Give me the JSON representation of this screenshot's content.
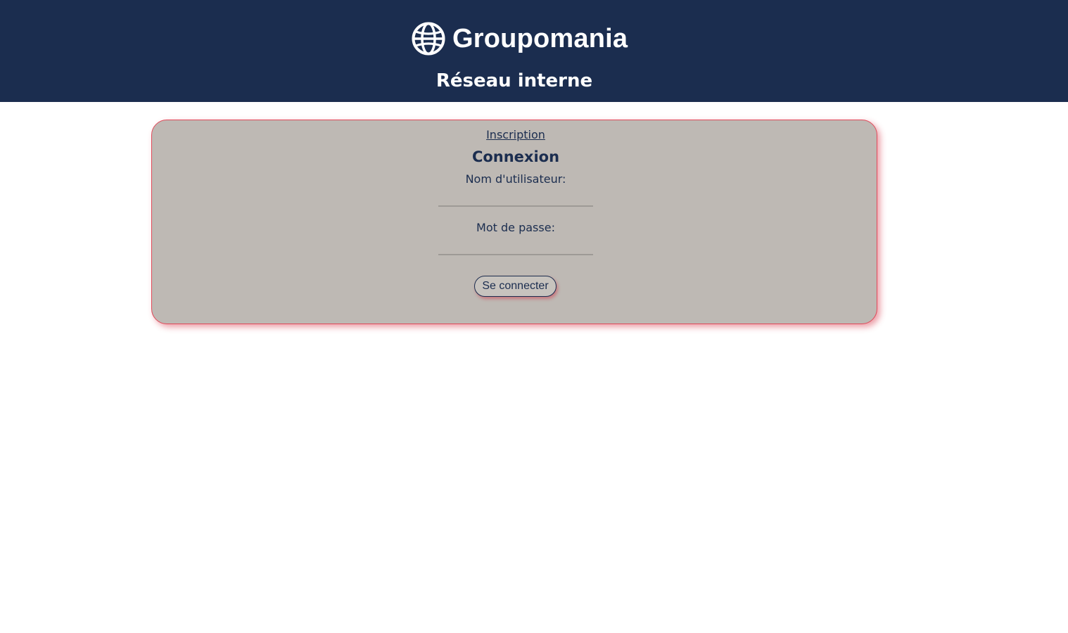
{
  "header": {
    "brand": "Groupomania",
    "logo_icon": "globe-icon",
    "subtitle": "Réseau interne",
    "background": "#1b2d4f"
  },
  "login_card": {
    "signup_link": "Inscription",
    "title": "Connexion",
    "username_label": "Nom d'utilisateur:",
    "username_value": "",
    "password_label": "Mot de passe:",
    "password_value": "",
    "submit_label": "Se connecter",
    "background": "#beb9b4",
    "border_color": "#e04a5a"
  }
}
